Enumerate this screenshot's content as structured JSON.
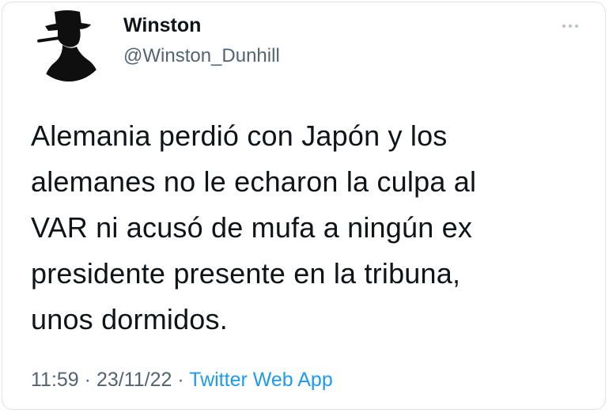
{
  "tweet": {
    "author": {
      "display_name": "Winston",
      "handle": "@Winston_Dunhill",
      "avatar_icon": "silhouette-hat-cigar-icon"
    },
    "text": "Alemania perdió con Japón y los\nalemanes no le echaron la culpa al\nVAR ni acusó de mufa a ningún ex\npresidente presente en la tribuna,\nunos dormidos.",
    "time": "11:59",
    "separator": " · ",
    "date": "23/11/22",
    "source": "Twitter Web App",
    "more_icon": "more-horizontal-icon"
  },
  "colors": {
    "text_primary": "#0f1419",
    "text_secondary": "#536471",
    "link": "#1d9bf0",
    "border": "#dfe3e6"
  }
}
